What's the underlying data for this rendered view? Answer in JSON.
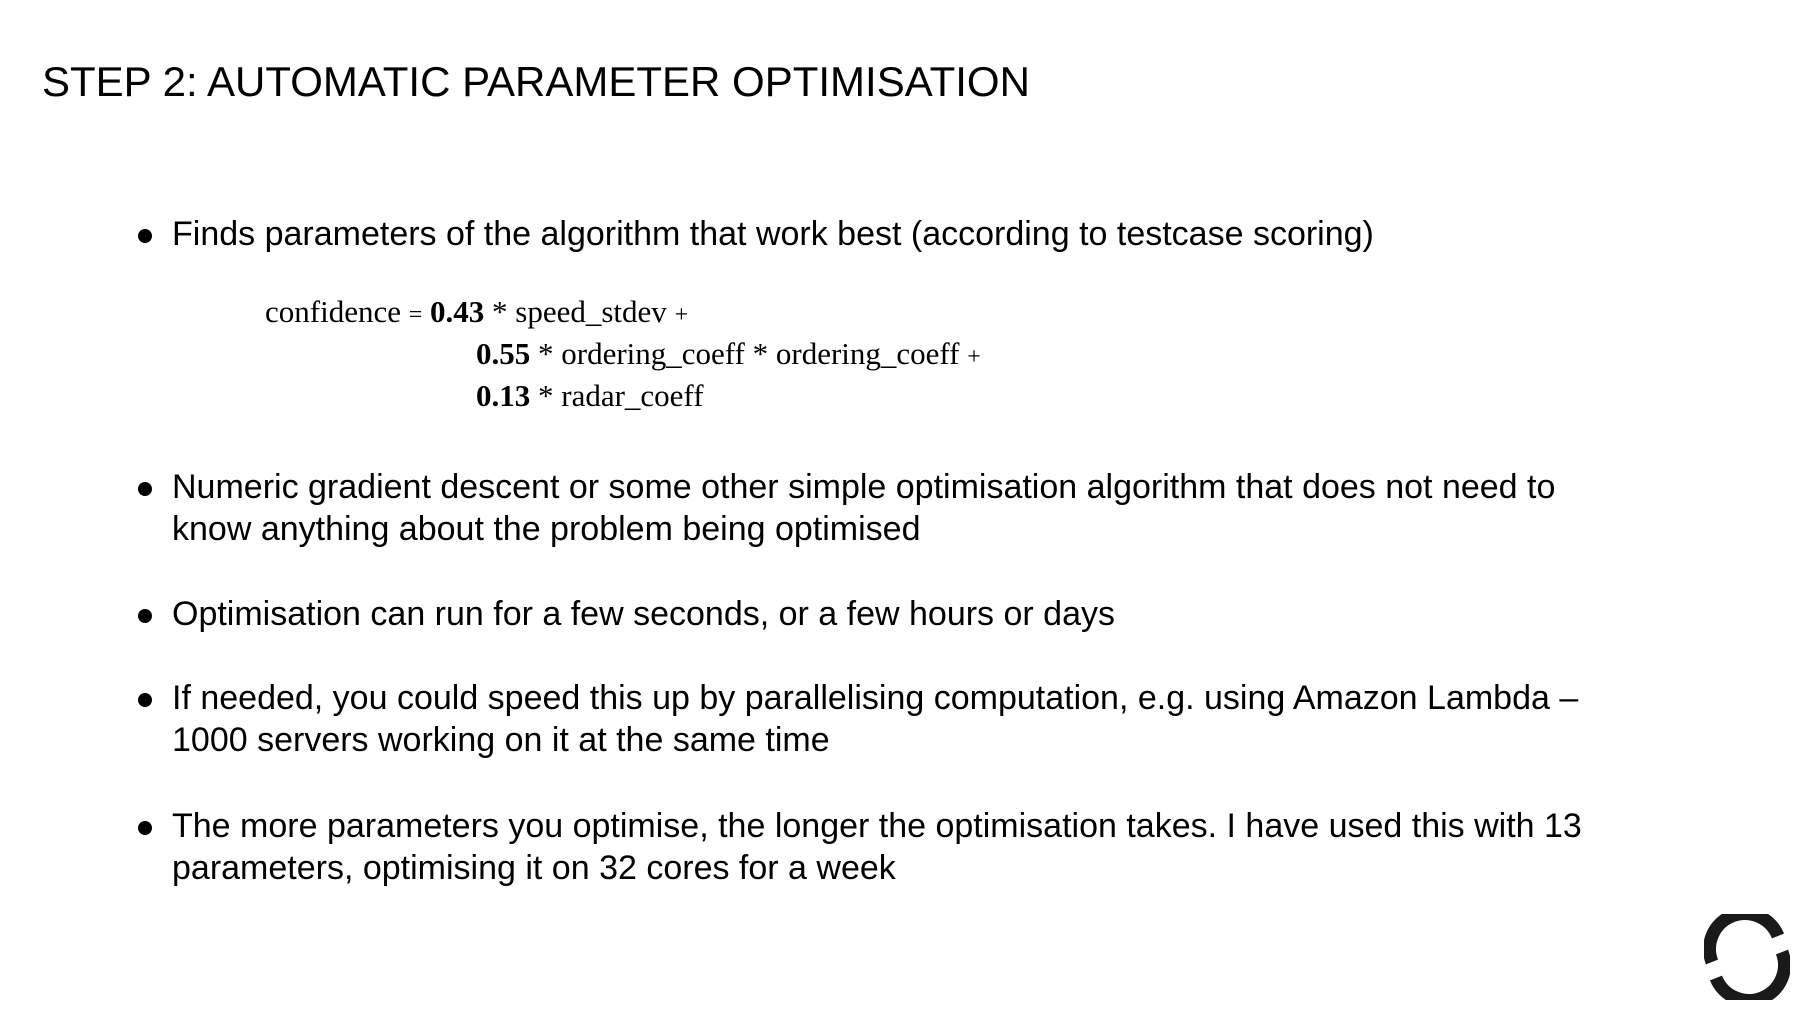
{
  "slide": {
    "title": "STEP 2: AUTOMATIC PARAMETER OPTIMISATION"
  },
  "bullets": [
    "Finds parameters of the algorithm that work best (according to testcase scoring)",
    "Numeric gradient descent or some other simple optimisation algorithm that does not need to know anything about the problem being optimised",
    "Optimisation can run for a few seconds, or a few hours or days",
    "If needed, you could speed this up by parallelising computation, e.g. using Amazon Lambda – 1000 servers working on it at the same time",
    "The more parameters you optimise, the longer the optimisation takes. I have used this with 13 parameters, optimising it on 32 cores for a week"
  ],
  "formula": {
    "lhs": "confidence",
    "equals": "=",
    "line1": {
      "coef": "0.43",
      "term": "* speed_stdev",
      "op": "+"
    },
    "line2": {
      "coef": "0.55",
      "term": "* ordering_coeff * ordering_coeff",
      "op": "+"
    },
    "line3": {
      "coef": "0.13",
      "term": "* radar_coeff"
    }
  },
  "logo": {
    "icon": "company-logo-icon",
    "color": "#1a1a1a"
  }
}
